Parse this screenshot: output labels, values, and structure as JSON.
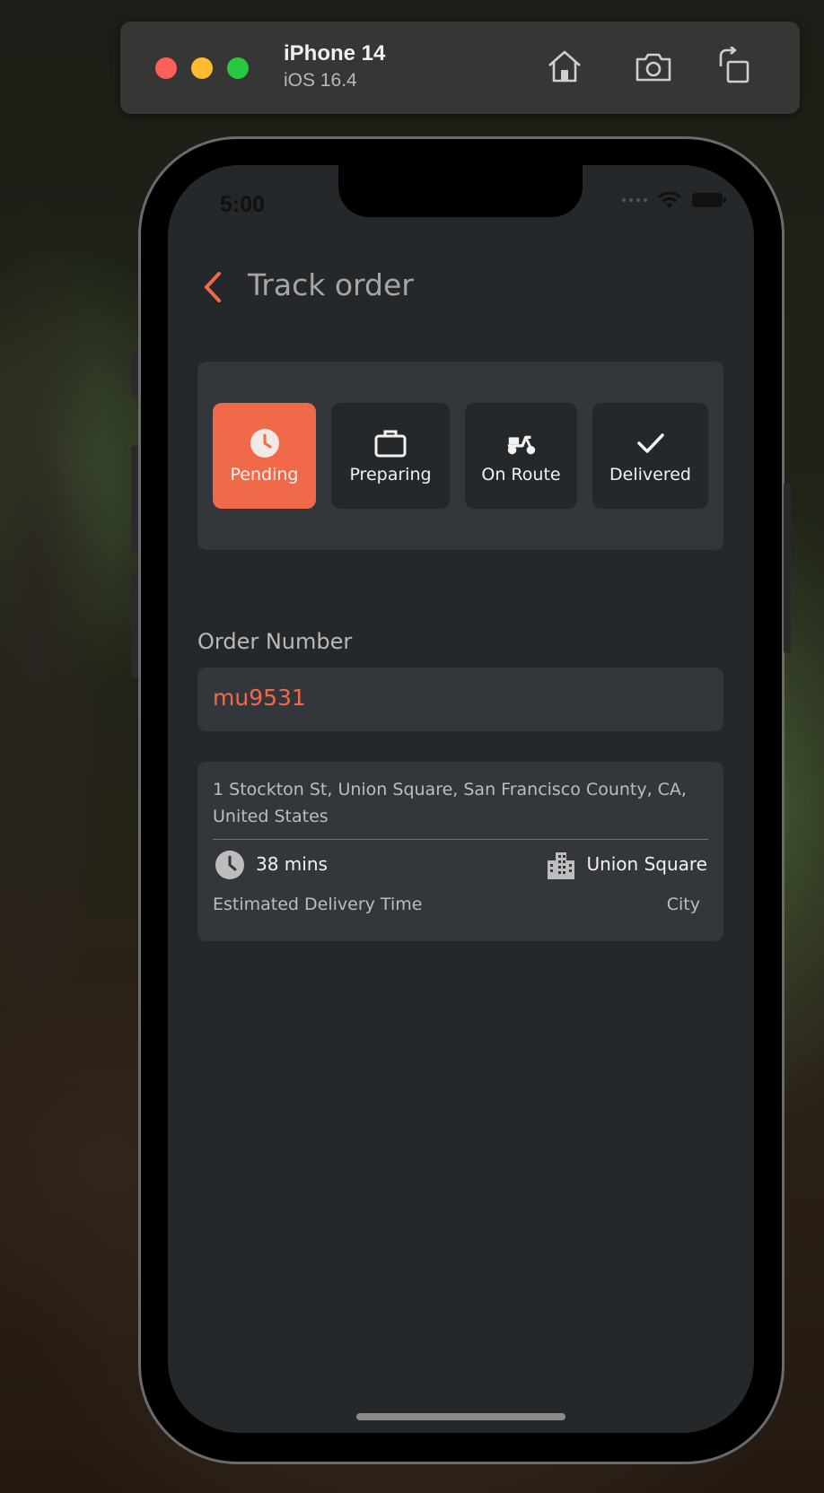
{
  "simulator": {
    "device_name": "iPhone 14",
    "os_version": "iOS 16.4",
    "controls": [
      "home-icon",
      "screenshot-icon",
      "rotate-icon"
    ]
  },
  "status_bar": {
    "time": "5:00"
  },
  "header": {
    "title": "Track order",
    "back_icon": "chevron-left-icon"
  },
  "order_steps": [
    {
      "label": "Pending",
      "icon": "clock-icon",
      "active": true
    },
    {
      "label": "Preparing",
      "icon": "briefcase-icon",
      "active": false
    },
    {
      "label": "On Route",
      "icon": "scooter-icon",
      "active": false
    },
    {
      "label": "Delivered",
      "icon": "check-icon",
      "active": false
    }
  ],
  "order_number": {
    "label": "Order Number",
    "value": "mu9531"
  },
  "delivery": {
    "address": "1 Stockton St, Union Square, San Francisco County, CA, United States",
    "time_value": "38 mins",
    "time_label": "Estimated Delivery Time",
    "area_value": "Union Square",
    "area_label": "City"
  },
  "colors": {
    "accent": "#f06a4a",
    "screen_bg": "#25282b",
    "card_bg": "#33373b"
  }
}
